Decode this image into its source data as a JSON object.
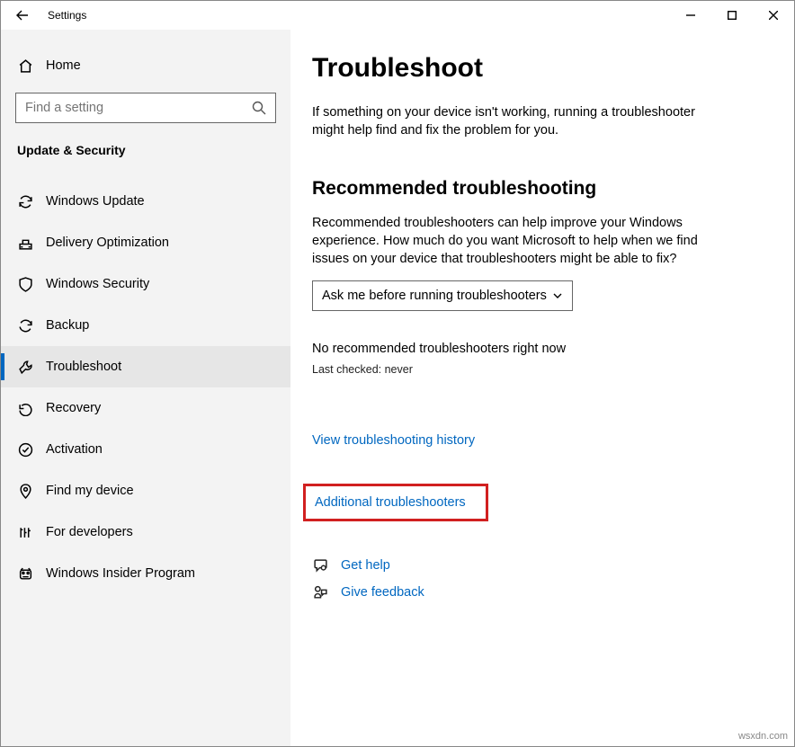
{
  "titlebar": {
    "app_name": "Settings"
  },
  "sidebar": {
    "home_label": "Home",
    "search_placeholder": "Find a setting",
    "category_title": "Update & Security",
    "items": [
      {
        "label": "Windows Update"
      },
      {
        "label": "Delivery Optimization"
      },
      {
        "label": "Windows Security"
      },
      {
        "label": "Backup"
      },
      {
        "label": "Troubleshoot"
      },
      {
        "label": "Recovery"
      },
      {
        "label": "Activation"
      },
      {
        "label": "Find my device"
      },
      {
        "label": "For developers"
      },
      {
        "label": "Windows Insider Program"
      }
    ]
  },
  "main": {
    "title": "Troubleshoot",
    "intro": "If something on your device isn't working, running a troubleshooter might help find and fix the problem for you.",
    "section_heading": "Recommended troubleshooting",
    "section_desc": "Recommended troubleshooters can help improve your Windows experience. How much do you want Microsoft to help when we find issues on your device that troubleshooters might be able to fix?",
    "dropdown_value": "Ask me before running troubleshooters",
    "no_rec": "No recommended troubleshooters right now",
    "last_checked": "Last checked: never",
    "history_link": "View troubleshooting history",
    "additional_link": "Additional troubleshooters",
    "get_help": "Get help",
    "give_feedback": "Give feedback"
  },
  "watermark": "wsxdn.com"
}
